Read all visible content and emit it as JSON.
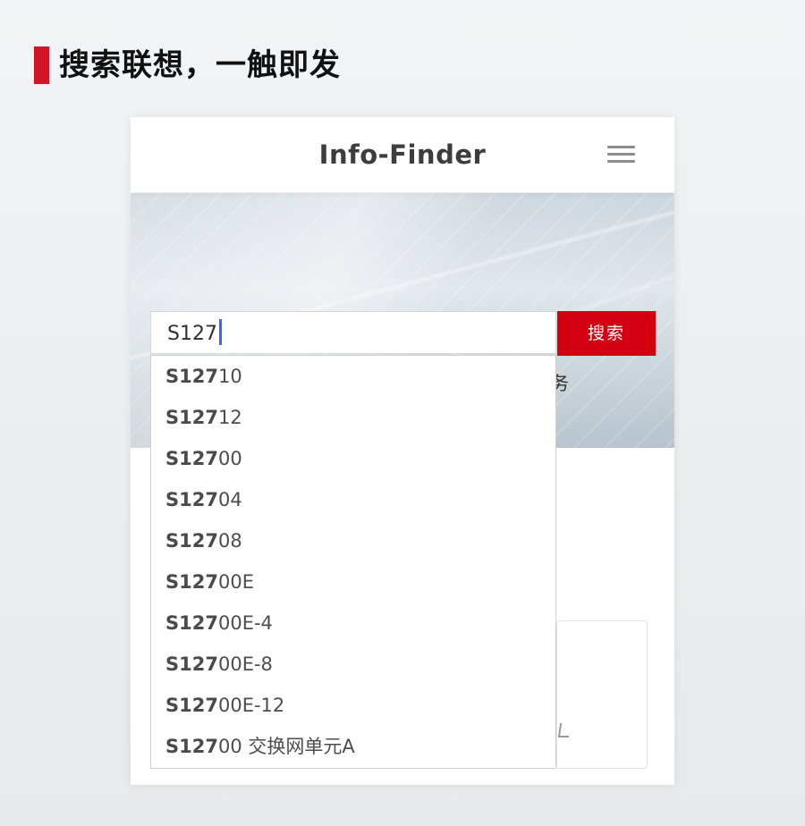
{
  "page": {
    "title": "搜索联想，一触即发",
    "accent_color": "#d11524"
  },
  "app": {
    "name": "Info-Finder",
    "menu_icon": "hamburger-menu-icon",
    "slogan": "提供友好、便捷、智能的信息查询服务",
    "search": {
      "value": "S127",
      "button_label": "搜索",
      "button_color": "#d40012",
      "caret_color": "#2e6ee8"
    },
    "suggestions": [
      {
        "match": "S127",
        "rest": "10"
      },
      {
        "match": "S127",
        "rest": "12"
      },
      {
        "match": "S127",
        "rest": "00"
      },
      {
        "match": "S127",
        "rest": "04"
      },
      {
        "match": "S127",
        "rest": "08"
      },
      {
        "match": "S127",
        "rest": "00E"
      },
      {
        "match": "S127",
        "rest": "00E-4"
      },
      {
        "match": "S127",
        "rest": "00E-8"
      },
      {
        "match": "S127",
        "rest": "00E-12"
      },
      {
        "match": "S127",
        "rest": "00 交换网单元A"
      }
    ]
  }
}
